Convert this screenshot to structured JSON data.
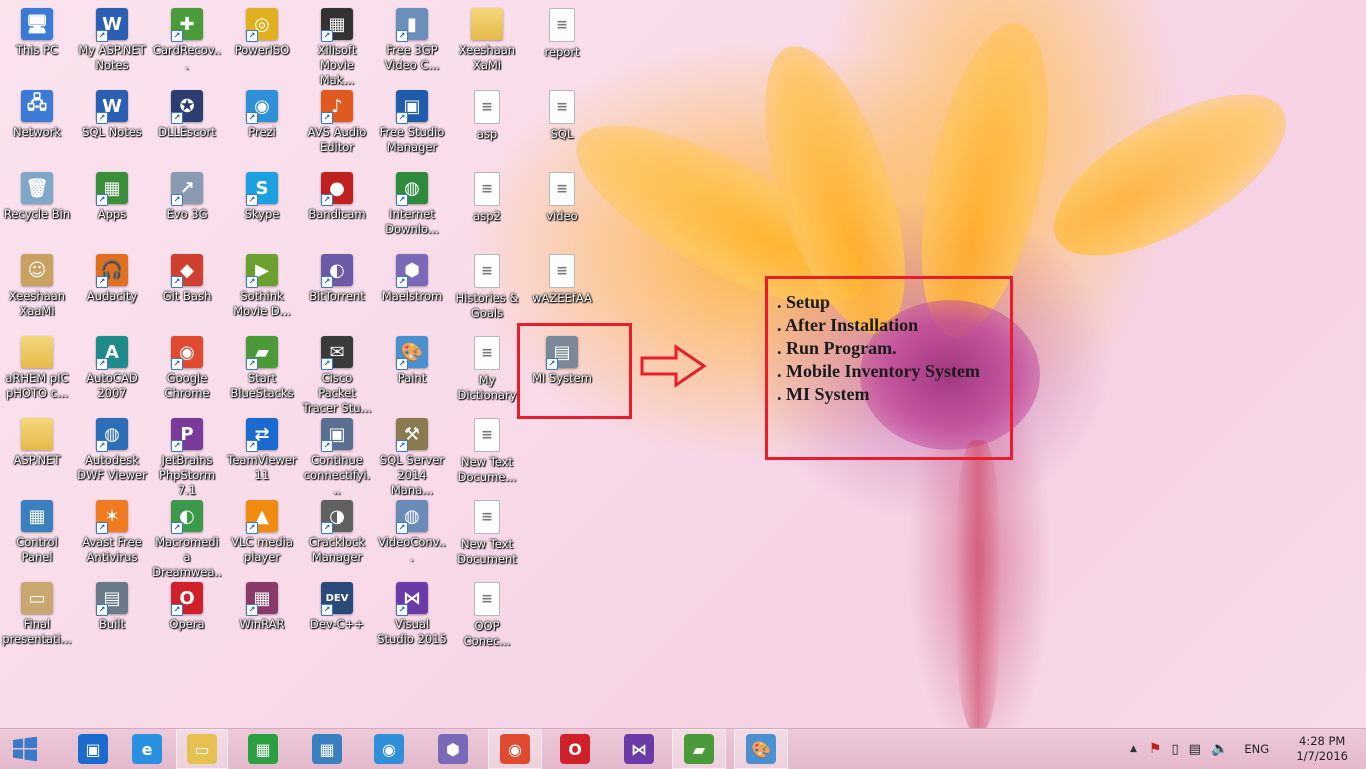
{
  "desktop": {
    "icons": [
      {
        "label": "This PC",
        "glyph": "🖥",
        "bg": "#3b7bd6",
        "kind": "app",
        "shortcut": false,
        "col": 0,
        "row": 0
      },
      {
        "label": "My ASP.NET Notes",
        "glyph": "W",
        "bg": "#2b5fb4",
        "kind": "app",
        "shortcut": true,
        "col": 1,
        "row": 0
      },
      {
        "label": "CardRecov...",
        "glyph": "✚",
        "bg": "#4a9b3a",
        "kind": "app",
        "shortcut": true,
        "col": 2,
        "row": 0
      },
      {
        "label": "PowerISO",
        "glyph": "◎",
        "bg": "#e0b020",
        "kind": "app",
        "shortcut": true,
        "col": 3,
        "row": 0
      },
      {
        "label": "Xilisoft Movie Mak...",
        "glyph": "▦",
        "bg": "#333",
        "kind": "app",
        "shortcut": true,
        "col": 4,
        "row": 0
      },
      {
        "label": "Free 3GP Video C...",
        "glyph": "▮",
        "bg": "#6a8fb8",
        "kind": "app",
        "shortcut": true,
        "col": 5,
        "row": 0
      },
      {
        "label": "Xeeshaan XaMi",
        "glyph": "",
        "bg": "",
        "kind": "folder",
        "shortcut": false,
        "col": 6,
        "row": 0
      },
      {
        "label": "report",
        "glyph": "≡",
        "bg": "",
        "kind": "doc",
        "shortcut": false,
        "col": 7,
        "row": 0
      },
      {
        "label": "Network",
        "glyph": "🖧",
        "bg": "#3b7bd6",
        "kind": "app",
        "shortcut": false,
        "col": 0,
        "row": 1
      },
      {
        "label": "SQL Notes",
        "glyph": "W",
        "bg": "#2b5fb4",
        "kind": "app",
        "shortcut": true,
        "col": 1,
        "row": 1
      },
      {
        "label": "DLLEscort",
        "glyph": "✪",
        "bg": "#2c3e70",
        "kind": "app",
        "shortcut": true,
        "col": 2,
        "row": 1
      },
      {
        "label": "Prezi",
        "glyph": "◉",
        "bg": "#2f8fd8",
        "kind": "app",
        "shortcut": true,
        "col": 3,
        "row": 1
      },
      {
        "label": "AVS Audio Editor",
        "glyph": "♪",
        "bg": "#e05a20",
        "kind": "app",
        "shortcut": true,
        "col": 4,
        "row": 1
      },
      {
        "label": "Free Studio Manager",
        "glyph": "▣",
        "bg": "#1f5cab",
        "kind": "app",
        "shortcut": true,
        "col": 5,
        "row": 1
      },
      {
        "label": "asp",
        "glyph": "≡",
        "bg": "",
        "kind": "doc",
        "shortcut": false,
        "col": 6,
        "row": 1
      },
      {
        "label": "SQL",
        "glyph": "≡",
        "bg": "",
        "kind": "doc",
        "shortcut": false,
        "col": 7,
        "row": 1
      },
      {
        "label": "Recycle Bin",
        "glyph": "🗑",
        "bg": "#7fa7c9",
        "kind": "app",
        "shortcut": false,
        "col": 0,
        "row": 2
      },
      {
        "label": "Apps",
        "glyph": "▦",
        "bg": "#3a8f3a",
        "kind": "app",
        "shortcut": true,
        "col": 1,
        "row": 2
      },
      {
        "label": "Evo 3G",
        "glyph": "↗",
        "bg": "#8a9ab0",
        "kind": "app",
        "shortcut": true,
        "col": 2,
        "row": 2
      },
      {
        "label": "Skype",
        "glyph": "S",
        "bg": "#1ca0e0",
        "kind": "app",
        "shortcut": true,
        "col": 3,
        "row": 2
      },
      {
        "label": "Bandicam",
        "glyph": "●",
        "bg": "#c02020",
        "kind": "app",
        "shortcut": true,
        "col": 4,
        "row": 2
      },
      {
        "label": "Internet Downlo...",
        "glyph": "◍",
        "bg": "#2e8b3e",
        "kind": "app",
        "shortcut": true,
        "col": 5,
        "row": 2
      },
      {
        "label": "asp2",
        "glyph": "≡",
        "bg": "",
        "kind": "doc",
        "shortcut": false,
        "col": 6,
        "row": 2
      },
      {
        "label": "video",
        "glyph": "≡",
        "bg": "",
        "kind": "doc",
        "shortcut": false,
        "col": 7,
        "row": 2
      },
      {
        "label": "Xeeshaan XaaMi",
        "glyph": "☺",
        "bg": "#c8a060",
        "kind": "app",
        "shortcut": false,
        "col": 0,
        "row": 3
      },
      {
        "label": "Audacity",
        "glyph": "🎧",
        "bg": "#e07020",
        "kind": "app",
        "shortcut": true,
        "col": 1,
        "row": 3
      },
      {
        "label": "Git Bash",
        "glyph": "◆",
        "bg": "#d04030",
        "kind": "app",
        "shortcut": true,
        "col": 2,
        "row": 3
      },
      {
        "label": "Sothink Movie D...",
        "glyph": "▶",
        "bg": "#6aa030",
        "kind": "app",
        "shortcut": true,
        "col": 3,
        "row": 3
      },
      {
        "label": "BitTorrent",
        "glyph": "◐",
        "bg": "#6a5aa8",
        "kind": "app",
        "shortcut": true,
        "col": 4,
        "row": 3
      },
      {
        "label": "Maelstrom",
        "glyph": "⬢",
        "bg": "#7a68b8",
        "kind": "app",
        "shortcut": true,
        "col": 5,
        "row": 3
      },
      {
        "label": "Histories & Goals",
        "glyph": "≡",
        "bg": "",
        "kind": "doc",
        "shortcut": false,
        "col": 6,
        "row": 3
      },
      {
        "label": "wAZEEfAA",
        "glyph": "≡",
        "bg": "",
        "kind": "doc",
        "shortcut": false,
        "col": 7,
        "row": 3
      },
      {
        "label": "aRHEM pIC pHOTO c...",
        "glyph": "",
        "bg": "",
        "kind": "folder",
        "shortcut": false,
        "col": 0,
        "row": 4
      },
      {
        "label": "AutoCAD 2007",
        "glyph": "A",
        "bg": "#1e8a8a",
        "kind": "app",
        "shortcut": true,
        "col": 1,
        "row": 4
      },
      {
        "label": "Google Chrome",
        "glyph": "◉",
        "bg": "#e04a30",
        "kind": "app",
        "shortcut": true,
        "col": 2,
        "row": 4
      },
      {
        "label": "Start BlueStacks",
        "glyph": "▰",
        "bg": "#4a9a3a",
        "kind": "app",
        "shortcut": true,
        "col": 3,
        "row": 4
      },
      {
        "label": "Cisco Packet Tracer Stu...",
        "glyph": "✉",
        "bg": "#3a3a3a",
        "kind": "app",
        "shortcut": true,
        "col": 4,
        "row": 4
      },
      {
        "label": "Paint",
        "glyph": "🎨",
        "bg": "#4a8fd0",
        "kind": "app",
        "shortcut": true,
        "col": 5,
        "row": 4
      },
      {
        "label": "My Dictionary",
        "glyph": "≡",
        "bg": "",
        "kind": "doc",
        "shortcut": false,
        "col": 6,
        "row": 4
      },
      {
        "label": "MI System",
        "glyph": "▤",
        "bg": "#7a8898",
        "kind": "app",
        "shortcut": true,
        "col": 7,
        "row": 4
      },
      {
        "label": "ASP.NET",
        "glyph": "",
        "bg": "",
        "kind": "folder",
        "shortcut": false,
        "col": 0,
        "row": 5
      },
      {
        "label": "Autodesk DWF Viewer",
        "glyph": "◍",
        "bg": "#2c6fb8",
        "kind": "app",
        "shortcut": true,
        "col": 1,
        "row": 5
      },
      {
        "label": "JetBrains PhpStorm 7.1",
        "glyph": "P",
        "bg": "#7a3a9a",
        "kind": "app",
        "shortcut": true,
        "col": 2,
        "row": 5
      },
      {
        "label": "TeamViewer 11",
        "glyph": "⇄",
        "bg": "#1a6ad0",
        "kind": "app",
        "shortcut": true,
        "col": 3,
        "row": 5
      },
      {
        "label": "Continue connectifyi...",
        "glyph": "▣",
        "bg": "#5a7090",
        "kind": "app",
        "shortcut": true,
        "col": 4,
        "row": 5
      },
      {
        "label": "SQL Server 2014 Mana...",
        "glyph": "⚒",
        "bg": "#8a7a50",
        "kind": "app",
        "shortcut": true,
        "col": 5,
        "row": 5
      },
      {
        "label": "New Text Docume...",
        "glyph": "≡",
        "bg": "",
        "kind": "doc",
        "shortcut": false,
        "col": 6,
        "row": 5
      },
      {
        "label": "Control Panel",
        "glyph": "▦",
        "bg": "#3a80c0",
        "kind": "app",
        "shortcut": false,
        "col": 0,
        "row": 6
      },
      {
        "label": "Avast Free Antivirus",
        "glyph": "✶",
        "bg": "#f07a20",
        "kind": "app",
        "shortcut": true,
        "col": 1,
        "row": 6
      },
      {
        "label": "Macromedia Dreamwea...",
        "glyph": "◐",
        "bg": "#3a9a4a",
        "kind": "app",
        "shortcut": true,
        "col": 2,
        "row": 6
      },
      {
        "label": "VLC media player",
        "glyph": "▲",
        "bg": "#f08a10",
        "kind": "app",
        "shortcut": true,
        "col": 3,
        "row": 6
      },
      {
        "label": "Cracklock Manager",
        "glyph": "◑",
        "bg": "#606060",
        "kind": "app",
        "shortcut": true,
        "col": 4,
        "row": 6
      },
      {
        "label": "VideoConv...",
        "glyph": "◍",
        "bg": "#6a8ab8",
        "kind": "app",
        "shortcut": true,
        "col": 5,
        "row": 6
      },
      {
        "label": "New Text Document",
        "glyph": "≡",
        "bg": "",
        "kind": "doc",
        "shortcut": false,
        "col": 6,
        "row": 6
      },
      {
        "label": "Final presentati...",
        "glyph": "▭",
        "bg": "#c8a870",
        "kind": "app",
        "shortcut": false,
        "col": 0,
        "row": 7
      },
      {
        "label": "Built",
        "glyph": "▤",
        "bg": "#6a7a8a",
        "kind": "app",
        "shortcut": true,
        "col": 1,
        "row": 7
      },
      {
        "label": "Opera",
        "glyph": "O",
        "bg": "#d0202a",
        "kind": "app",
        "shortcut": true,
        "col": 2,
        "row": 7
      },
      {
        "label": "WinRAR",
        "glyph": "▦",
        "bg": "#8a3a6a",
        "kind": "app",
        "shortcut": true,
        "col": 3,
        "row": 7
      },
      {
        "label": "Dev-C++",
        "glyph": "DEV",
        "bg": "#2a4a7a",
        "kind": "app",
        "shortcut": true,
        "col": 4,
        "row": 7
      },
      {
        "label": "Visual Studio 2015",
        "glyph": "⋈",
        "bg": "#6a3aa8",
        "kind": "app",
        "shortcut": true,
        "col": 5,
        "row": 7
      },
      {
        "label": "OOP Conec...",
        "glyph": "≡",
        "bg": "",
        "kind": "doc",
        "shortcut": false,
        "col": 6,
        "row": 7
      }
    ]
  },
  "annotation": {
    "lines": [
      ". Setup",
      ". After Installation",
      ". Run Program.",
      ". Mobile Inventory System",
      ". MI System"
    ],
    "color": "#e81c2a"
  },
  "taskbar": {
    "start_icon": "windows-logo-icon",
    "pinned": [
      {
        "name": "intel-graphics-icon",
        "glyph": "▣",
        "bg": "#1a6ad0",
        "active": false
      },
      {
        "name": "internet-explorer-icon",
        "glyph": "e",
        "bg": "#2a90e0",
        "active": false
      },
      {
        "name": "file-explorer-icon",
        "glyph": "▭",
        "bg": "#e6c050",
        "active": true
      },
      {
        "name": "store-icon",
        "glyph": "▦",
        "bg": "#2aa040",
        "active": false
      },
      {
        "name": "control-panel-icon",
        "glyph": "▦",
        "bg": "#3a80c0",
        "active": false
      },
      {
        "name": "prezi-icon",
        "glyph": "◉",
        "bg": "#2f8fd8",
        "active": false
      },
      {
        "name": "maelstrom-icon",
        "glyph": "⬢",
        "bg": "#7a68b8",
        "active": false
      },
      {
        "name": "chrome-icon",
        "glyph": "◉",
        "bg": "#e04a30",
        "active": true
      },
      {
        "name": "opera-icon",
        "glyph": "O",
        "bg": "#d0202a",
        "active": false
      },
      {
        "name": "visual-studio-icon",
        "glyph": "⋈",
        "bg": "#6a3aa8",
        "active": false
      },
      {
        "name": "bluestacks-icon",
        "glyph": "▰",
        "bg": "#4a9a3a",
        "active": true
      },
      {
        "name": "paint-icon",
        "glyph": "🎨",
        "bg": "#4a8fd0",
        "active": true
      }
    ],
    "tray": {
      "chevron": "▲",
      "language": "ENG",
      "time": "4:28 PM",
      "date": "1/7/2016"
    }
  }
}
